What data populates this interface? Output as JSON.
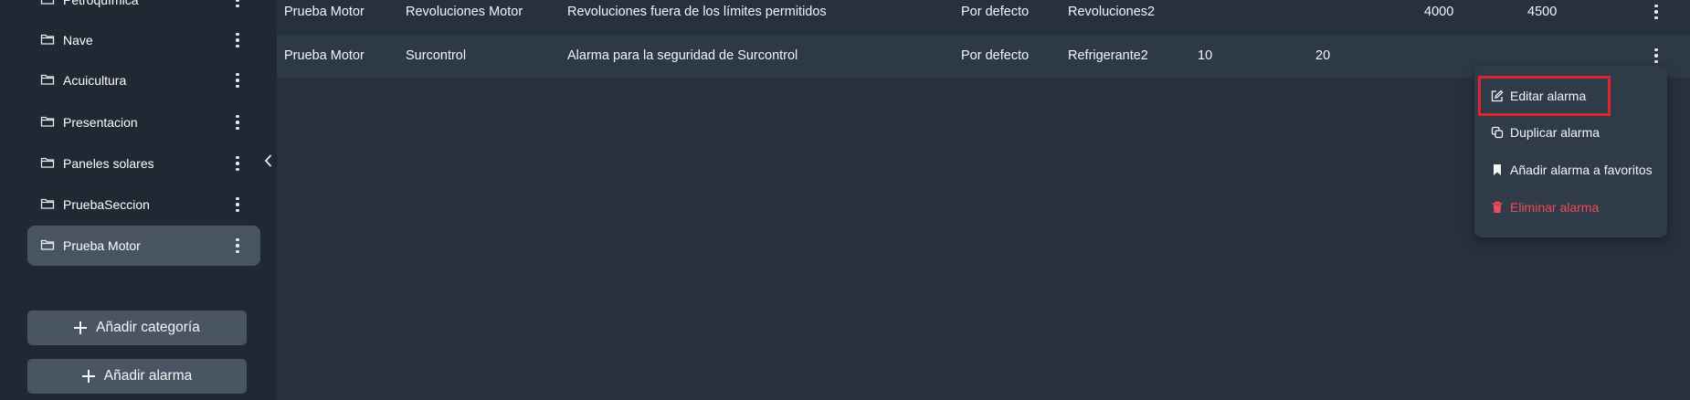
{
  "sidebar": {
    "categories": [
      {
        "label": "Petroquímica"
      },
      {
        "label": "Nave"
      },
      {
        "label": "Acuicultura"
      },
      {
        "label": "Presentacion"
      },
      {
        "label": "Paneles solares"
      },
      {
        "label": "PruebaSeccion"
      },
      {
        "label": "Prueba Motor"
      }
    ],
    "active_category": "Prueba Motor",
    "add_category_label": "Añadir categoría",
    "add_alarm_label": "Añadir alarma"
  },
  "table": {
    "rows": [
      {
        "category": "Prueba Motor",
        "variable": "Revoluciones Motor",
        "description": "Revoluciones fuera de los límites permitidos",
        "type": "Por defecto",
        "tag": "Revoluciones2",
        "min": "",
        "max": "",
        "low": "4000",
        "high": "4500"
      },
      {
        "category": "Prueba Motor",
        "variable": "Surcontrol",
        "description": "Alarma para la seguridad de Surcontrol",
        "type": "Por defecto",
        "tag": "Refrigerante2",
        "min": "10",
        "max": "20",
        "low": "",
        "high": ""
      }
    ]
  },
  "context_menu": {
    "items": [
      {
        "label": "Editar alarma",
        "icon": "edit-icon"
      },
      {
        "label": "Duplicar alarma",
        "icon": "duplicate-icon"
      },
      {
        "label": "Añadir alarma a favoritos",
        "icon": "bookmark-icon"
      },
      {
        "label": "Eliminar alarma",
        "icon": "trash-icon",
        "color": "#ef4a5a"
      }
    ],
    "highlighted_item": "Editar alarma"
  },
  "colors": {
    "background": "#1f2833",
    "panel": "#27313d",
    "row_alt": "#2e3946",
    "active_item": "#485462",
    "button": "#4a5563",
    "danger": "#ef4a5a",
    "highlight_border": "#e0242f"
  }
}
